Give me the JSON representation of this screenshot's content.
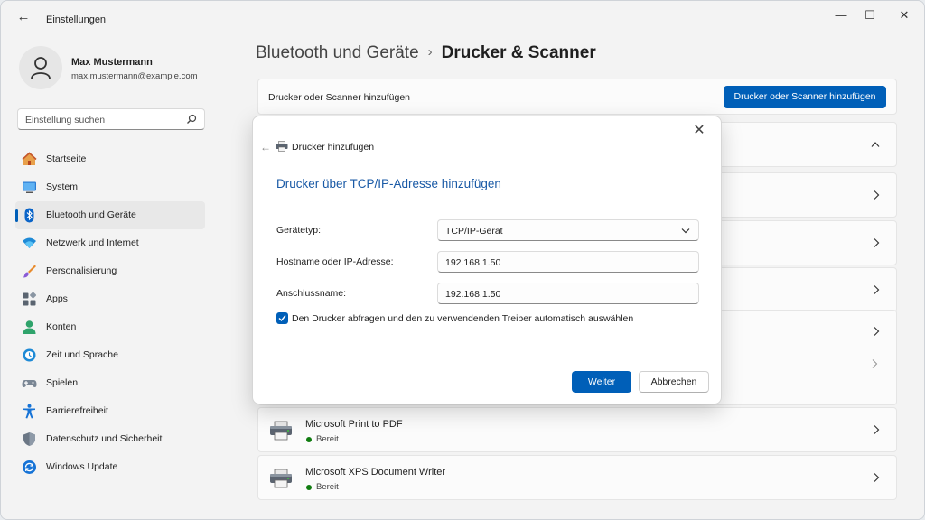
{
  "window": {
    "title": "Einstellungen",
    "controls": {
      "minimize": "—",
      "maximize": "☐",
      "close": "✕"
    }
  },
  "profile": {
    "name": "Max Mustermann",
    "email": "max.mustermann@example.com"
  },
  "search": {
    "placeholder": "Einstellung suchen"
  },
  "sidebar": {
    "items": [
      {
        "label": "Startseite",
        "icon": "home-icon"
      },
      {
        "label": "System",
        "icon": "system-icon"
      },
      {
        "label": "Bluetooth und Geräte",
        "icon": "bluetooth-icon",
        "active": true
      },
      {
        "label": "Netzwerk und Internet",
        "icon": "wifi-icon"
      },
      {
        "label": "Personalisierung",
        "icon": "brush-icon"
      },
      {
        "label": "Apps",
        "icon": "apps-icon"
      },
      {
        "label": "Konten",
        "icon": "person-icon"
      },
      {
        "label": "Zeit und Sprache",
        "icon": "globe-clock-icon"
      },
      {
        "label": "Spielen",
        "icon": "gamepad-icon"
      },
      {
        "label": "Barrierefreiheit",
        "icon": "accessibility-icon"
      },
      {
        "label": "Datenschutz und Sicherheit",
        "icon": "shield-icon"
      },
      {
        "label": "Windows Update",
        "icon": "update-icon"
      }
    ]
  },
  "breadcrumb": {
    "parent": "Bluetooth und Geräte",
    "separator": "›",
    "current": "Drucker & Scanner"
  },
  "main": {
    "add_label": "Drucker oder Scanner hinzufügen",
    "add_button": "Drucker oder Scanner hinzufügen",
    "printers": [
      {
        "name": "Microsoft Print to PDF",
        "status": "Bereit"
      },
      {
        "name": "Microsoft XPS Document Writer",
        "status": "Bereit"
      }
    ]
  },
  "dialog": {
    "title": "Drucker hinzufügen",
    "heading": "Drucker über TCP/IP-Adresse hinzufügen",
    "close": "✕",
    "back": "←",
    "fields": {
      "type_label": "Gerätetyp:",
      "type_value": "TCP/IP-Gerät",
      "host_label": "Hostname oder IP-Adresse:",
      "host_value": "192.168.1.50",
      "port_label": "Anschlussname:",
      "port_value": "192.168.1.50"
    },
    "checkbox_label": "Den Drucker abfragen und den zu verwendenden Treiber automatisch auswählen",
    "checkbox_checked": true,
    "primary_button": "Weiter",
    "secondary_button": "Abbrechen"
  },
  "colors": {
    "accent": "#005fb8",
    "heading": "#1a5aa6",
    "status_ready": "#107c10"
  }
}
